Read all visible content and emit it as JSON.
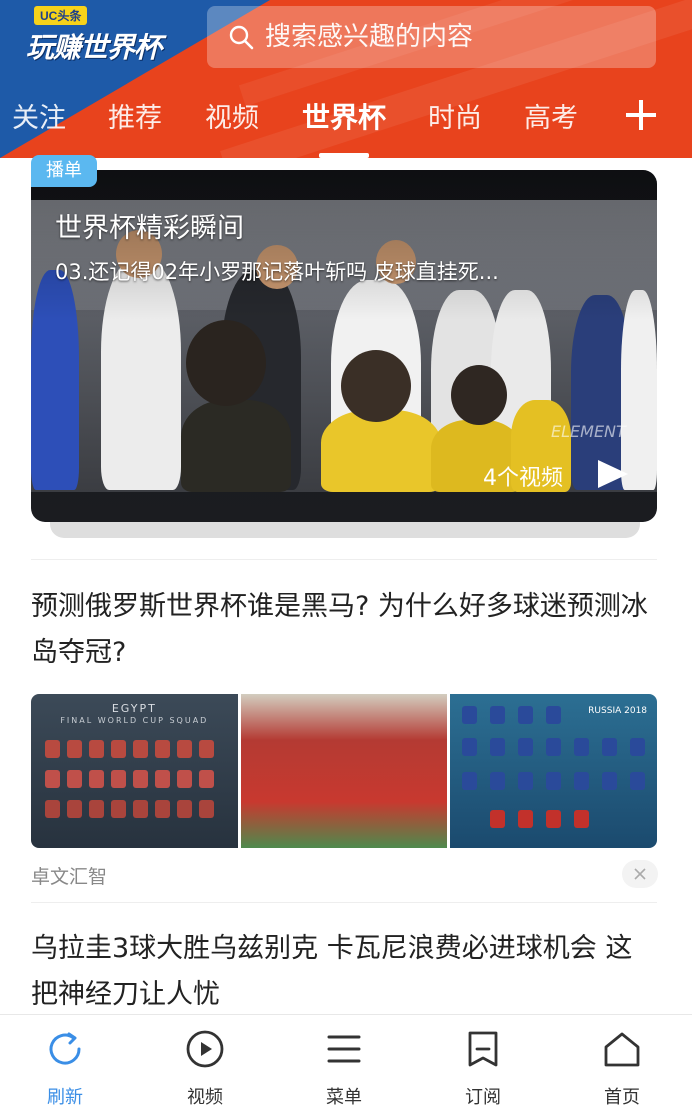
{
  "header": {
    "logo_badge": "UC头条",
    "logo_title": "玩赚世界杯",
    "search_placeholder": "搜索感兴趣的内容",
    "tabs": [
      {
        "label": "关注"
      },
      {
        "label": "推荐"
      },
      {
        "label": "视频"
      },
      {
        "label": "世界杯"
      },
      {
        "label": "时尚"
      },
      {
        "label": "高考"
      }
    ],
    "active_tab": "世界杯"
  },
  "playlist": {
    "tag": "播单",
    "title": "世界杯精彩瞬间",
    "subtitle": "03.还记得02年小罗那记落叶斩吗 皮球直挂死...",
    "count": "4个视频",
    "watermark": "ELEMENT"
  },
  "articles": [
    {
      "title": "预测俄罗斯世界杯谁是黑马? 为什么好多球迷预测冰岛夺冠?",
      "source": "卓文汇智",
      "thumb1_title": "EGYPT",
      "thumb1_sub": "FINAL WORLD CUP SQUAD",
      "thumb3_label": "RUSSIA 2018"
    },
    {
      "title": "乌拉圭3球大胜乌兹别克 卡瓦尼浪费必进球机会 这把神经刀让人忧"
    }
  ],
  "bottom_nav": [
    {
      "label": "刷新",
      "icon": "refresh-icon",
      "active": true
    },
    {
      "label": "视频",
      "icon": "play-circle-icon"
    },
    {
      "label": "菜单",
      "icon": "menu-icon"
    },
    {
      "label": "订阅",
      "icon": "subscribe-icon"
    },
    {
      "label": "首页",
      "icon": "home-icon"
    }
  ],
  "colors": {
    "header_red": "#e8431d",
    "header_blue": "#1e5aa8",
    "accent_blue": "#3a8ee6",
    "tag_blue": "#5bb8f0"
  }
}
